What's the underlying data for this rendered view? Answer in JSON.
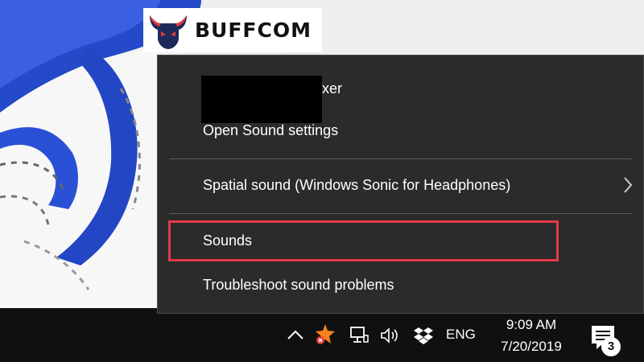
{
  "brand": {
    "name": "BUFFCOM"
  },
  "context_menu": {
    "items": [
      {
        "id": "volume-mixer",
        "label": "xer",
        "redacted": true
      },
      {
        "id": "open-sound-settings",
        "label": "Open Sound settings"
      },
      {
        "id": "spatial-sound",
        "label": "Spatial sound (Windows Sonic for Headphones)",
        "has_submenu": true,
        "icon": "chevron-right-icon"
      },
      {
        "id": "sounds",
        "label": "Sounds",
        "highlighted": true
      },
      {
        "id": "troubleshoot",
        "label": "Troubleshoot sound problems"
      }
    ],
    "highlight_color": "#e63946"
  },
  "taskbar": {
    "tray_icons": [
      {
        "name": "chevron-up-icon"
      },
      {
        "name": "avast-icon",
        "color": "#f7801e"
      },
      {
        "name": "network-icon"
      },
      {
        "name": "volume-icon"
      },
      {
        "name": "dropbox-icon"
      }
    ],
    "language": "ENG",
    "clock": {
      "time": "9:09 AM",
      "date": "7/20/2019"
    },
    "action_center": {
      "icon": "notification-icon",
      "count": "3"
    }
  },
  "colors": {
    "menu_background": "#2b2b2b",
    "taskbar_background": "#101010",
    "wallpaper_accent": "#2044c8"
  }
}
